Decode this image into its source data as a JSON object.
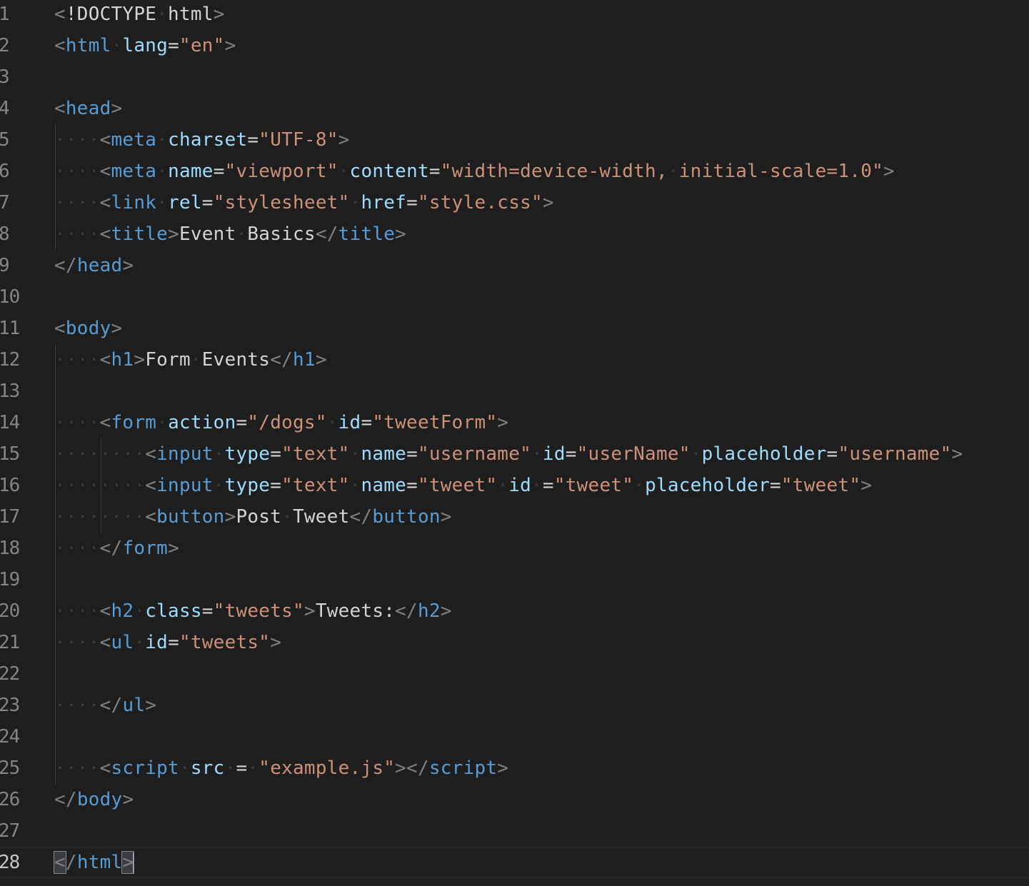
{
  "editor": {
    "current_line": 28,
    "lines": [
      {
        "n": "1",
        "indent": 0,
        "tokens": [
          [
            "punc",
            "<"
          ],
          [
            "text",
            "!DOCTYPE"
          ],
          [
            "ws",
            "·"
          ],
          [
            "text",
            "html"
          ],
          [
            "punc",
            ">"
          ]
        ]
      },
      {
        "n": "2",
        "indent": 0,
        "tokens": [
          [
            "punc",
            "<"
          ],
          [
            "tag",
            "html"
          ],
          [
            "ws",
            "·"
          ],
          [
            "attr",
            "lang"
          ],
          [
            "eq",
            "="
          ],
          [
            "str",
            "\"en\""
          ],
          [
            "punc",
            ">"
          ]
        ]
      },
      {
        "n": "3",
        "indent": 0,
        "tokens": []
      },
      {
        "n": "4",
        "indent": 0,
        "tokens": [
          [
            "punc",
            "<"
          ],
          [
            "tag",
            "head"
          ],
          [
            "punc",
            ">"
          ]
        ]
      },
      {
        "n": "5",
        "indent": 1,
        "tokens": [
          [
            "ws",
            "····"
          ],
          [
            "punc",
            "<"
          ],
          [
            "tag",
            "meta"
          ],
          [
            "ws",
            "·"
          ],
          [
            "attr",
            "charset"
          ],
          [
            "eq",
            "="
          ],
          [
            "str",
            "\"UTF-8\""
          ],
          [
            "punc",
            ">"
          ]
        ]
      },
      {
        "n": "6",
        "indent": 1,
        "tokens": [
          [
            "ws",
            "····"
          ],
          [
            "punc",
            "<"
          ],
          [
            "tag",
            "meta"
          ],
          [
            "ws",
            "·"
          ],
          [
            "attr",
            "name"
          ],
          [
            "eq",
            "="
          ],
          [
            "str",
            "\"viewport\""
          ],
          [
            "ws",
            "·"
          ],
          [
            "attr",
            "content"
          ],
          [
            "eq",
            "="
          ],
          [
            "str",
            "\"width=device-width,"
          ],
          [
            "ws",
            "·"
          ],
          [
            "str",
            "initial-scale=1.0\""
          ],
          [
            "punc",
            ">"
          ]
        ]
      },
      {
        "n": "7",
        "indent": 1,
        "tokens": [
          [
            "ws",
            "····"
          ],
          [
            "punc",
            "<"
          ],
          [
            "tag",
            "link"
          ],
          [
            "ws",
            "·"
          ],
          [
            "attr",
            "rel"
          ],
          [
            "eq",
            "="
          ],
          [
            "str",
            "\"stylesheet\""
          ],
          [
            "ws",
            "·"
          ],
          [
            "attr",
            "href"
          ],
          [
            "eq",
            "="
          ],
          [
            "str",
            "\"style.css\""
          ],
          [
            "punc",
            ">"
          ]
        ]
      },
      {
        "n": "8",
        "indent": 1,
        "tokens": [
          [
            "ws",
            "····"
          ],
          [
            "punc",
            "<"
          ],
          [
            "tag",
            "title"
          ],
          [
            "punc",
            ">"
          ],
          [
            "text",
            "Event"
          ],
          [
            "ws",
            "·"
          ],
          [
            "text",
            "Basics"
          ],
          [
            "punc",
            "</"
          ],
          [
            "tag",
            "title"
          ],
          [
            "punc",
            ">"
          ]
        ]
      },
      {
        "n": "9",
        "indent": 0,
        "tokens": [
          [
            "punc",
            "</"
          ],
          [
            "tag",
            "head"
          ],
          [
            "punc",
            ">"
          ]
        ]
      },
      {
        "n": "10",
        "indent": 0,
        "tokens": []
      },
      {
        "n": "11",
        "indent": 0,
        "tokens": [
          [
            "punc",
            "<"
          ],
          [
            "tag",
            "body"
          ],
          [
            "punc",
            ">"
          ]
        ]
      },
      {
        "n": "12",
        "indent": 1,
        "tokens": [
          [
            "ws",
            "····"
          ],
          [
            "punc",
            "<"
          ],
          [
            "tag",
            "h1"
          ],
          [
            "punc",
            ">"
          ],
          [
            "text",
            "Form"
          ],
          [
            "ws",
            "·"
          ],
          [
            "text",
            "Events"
          ],
          [
            "punc",
            "</"
          ],
          [
            "tag",
            "h1"
          ],
          [
            "punc",
            ">"
          ]
        ]
      },
      {
        "n": "13",
        "indent": 1,
        "tokens": []
      },
      {
        "n": "14",
        "indent": 1,
        "tokens": [
          [
            "ws",
            "····"
          ],
          [
            "punc",
            "<"
          ],
          [
            "tag",
            "form"
          ],
          [
            "ws",
            "·"
          ],
          [
            "attr",
            "action"
          ],
          [
            "eq",
            "="
          ],
          [
            "str",
            "\"/dogs\""
          ],
          [
            "ws",
            "·"
          ],
          [
            "attr",
            "id"
          ],
          [
            "eq",
            "="
          ],
          [
            "str",
            "\"tweetForm\""
          ],
          [
            "punc",
            ">"
          ]
        ]
      },
      {
        "n": "15",
        "indent": 2,
        "tokens": [
          [
            "ws",
            "········"
          ],
          [
            "punc",
            "<"
          ],
          [
            "tag",
            "input"
          ],
          [
            "ws",
            "·"
          ],
          [
            "attr",
            "type"
          ],
          [
            "eq",
            "="
          ],
          [
            "str",
            "\"text\""
          ],
          [
            "ws",
            "·"
          ],
          [
            "attr",
            "name"
          ],
          [
            "eq",
            "="
          ],
          [
            "str",
            "\"username\""
          ],
          [
            "ws",
            "·"
          ],
          [
            "attr",
            "id"
          ],
          [
            "eq",
            "="
          ],
          [
            "str",
            "\"userName\""
          ],
          [
            "ws",
            "·"
          ],
          [
            "attr",
            "placeholder"
          ],
          [
            "eq",
            "="
          ],
          [
            "str",
            "\"username\""
          ],
          [
            "punc",
            ">"
          ]
        ]
      },
      {
        "n": "16",
        "indent": 2,
        "tokens": [
          [
            "ws",
            "········"
          ],
          [
            "punc",
            "<"
          ],
          [
            "tag",
            "input"
          ],
          [
            "ws",
            "·"
          ],
          [
            "attr",
            "type"
          ],
          [
            "eq",
            "="
          ],
          [
            "str",
            "\"text\""
          ],
          [
            "ws",
            "·"
          ],
          [
            "attr",
            "name"
          ],
          [
            "eq",
            "="
          ],
          [
            "str",
            "\"tweet\""
          ],
          [
            "ws",
            "·"
          ],
          [
            "attr",
            "id"
          ],
          [
            "ws",
            "·"
          ],
          [
            "eq",
            "="
          ],
          [
            "str",
            "\"tweet\""
          ],
          [
            "ws",
            "·"
          ],
          [
            "attr",
            "placeholder"
          ],
          [
            "eq",
            "="
          ],
          [
            "str",
            "\"tweet\""
          ],
          [
            "punc",
            ">"
          ]
        ]
      },
      {
        "n": "17",
        "indent": 2,
        "tokens": [
          [
            "ws",
            "········"
          ],
          [
            "punc",
            "<"
          ],
          [
            "tag",
            "button"
          ],
          [
            "punc",
            ">"
          ],
          [
            "text",
            "Post"
          ],
          [
            "ws",
            "·"
          ],
          [
            "text",
            "Tweet"
          ],
          [
            "punc",
            "</"
          ],
          [
            "tag",
            "button"
          ],
          [
            "punc",
            ">"
          ]
        ]
      },
      {
        "n": "18",
        "indent": 1,
        "tokens": [
          [
            "ws",
            "····"
          ],
          [
            "punc",
            "</"
          ],
          [
            "tag",
            "form"
          ],
          [
            "punc",
            ">"
          ]
        ]
      },
      {
        "n": "19",
        "indent": 1,
        "tokens": []
      },
      {
        "n": "20",
        "indent": 1,
        "tokens": [
          [
            "ws",
            "····"
          ],
          [
            "punc",
            "<"
          ],
          [
            "tag",
            "h2"
          ],
          [
            "ws",
            "·"
          ],
          [
            "attr",
            "class"
          ],
          [
            "eq",
            "="
          ],
          [
            "str",
            "\"tweets\""
          ],
          [
            "punc",
            ">"
          ],
          [
            "text",
            "Tweets:"
          ],
          [
            "punc",
            "</"
          ],
          [
            "tag",
            "h2"
          ],
          [
            "punc",
            ">"
          ]
        ]
      },
      {
        "n": "21",
        "indent": 1,
        "tokens": [
          [
            "ws",
            "····"
          ],
          [
            "punc",
            "<"
          ],
          [
            "tag",
            "ul"
          ],
          [
            "ws",
            "·"
          ],
          [
            "attr",
            "id"
          ],
          [
            "eq",
            "="
          ],
          [
            "str",
            "\"tweets\""
          ],
          [
            "punc",
            ">"
          ]
        ]
      },
      {
        "n": "22",
        "indent": 1,
        "tokens": []
      },
      {
        "n": "23",
        "indent": 1,
        "tokens": [
          [
            "ws",
            "····"
          ],
          [
            "punc",
            "</"
          ],
          [
            "tag",
            "ul"
          ],
          [
            "punc",
            ">"
          ]
        ]
      },
      {
        "n": "24",
        "indent": 1,
        "tokens": []
      },
      {
        "n": "25",
        "indent": 1,
        "tokens": [
          [
            "ws",
            "····"
          ],
          [
            "punc",
            "<"
          ],
          [
            "tag",
            "script"
          ],
          [
            "ws",
            "·"
          ],
          [
            "attr",
            "src"
          ],
          [
            "ws",
            "·"
          ],
          [
            "eq",
            "="
          ],
          [
            "ws",
            "·"
          ],
          [
            "str",
            "\"example.js\""
          ],
          [
            "punc",
            "></"
          ],
          [
            "tag",
            "script"
          ],
          [
            "punc",
            ">"
          ]
        ]
      },
      {
        "n": "26",
        "indent": 0,
        "tokens": [
          [
            "punc",
            "</"
          ],
          [
            "tag",
            "body"
          ],
          [
            "punc",
            ">"
          ]
        ]
      },
      {
        "n": "27",
        "indent": 0,
        "tokens": []
      },
      {
        "n": "28",
        "indent": 0,
        "tokens": [
          [
            "bracket",
            "<"
          ],
          [
            "punc",
            "/"
          ],
          [
            "tag",
            "html"
          ],
          [
            "bracket",
            ">"
          ],
          [
            "cursor",
            ""
          ]
        ]
      }
    ]
  }
}
